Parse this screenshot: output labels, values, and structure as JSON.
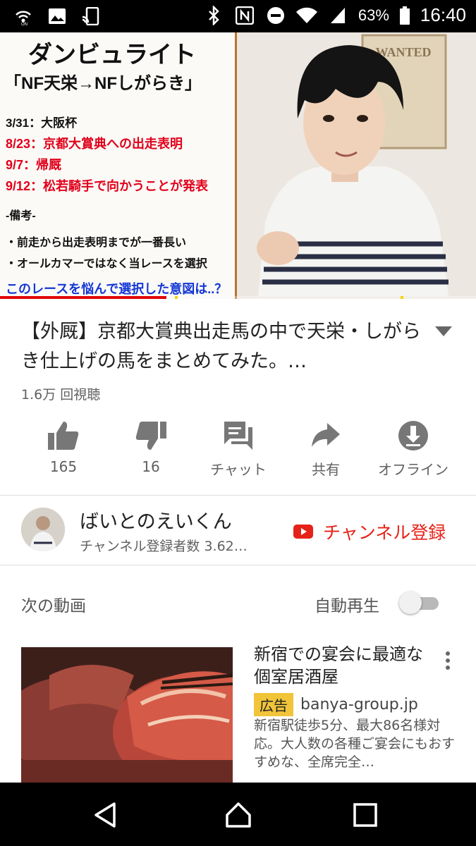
{
  "status_bar": {
    "battery_percent": "63%",
    "time": "16:40",
    "icons": [
      "wifi-calling-icon",
      "image-icon",
      "cast-icon",
      "bluetooth-icon",
      "nfc-icon",
      "do-not-disturb-icon",
      "wifi-icon",
      "signal-icon",
      "battery-icon"
    ]
  },
  "video": {
    "board_title": "ダンビュライト",
    "board_subtitle": "「NF天栄→NFしがらき」",
    "board_lines": [
      {
        "text": "3/31：大阪杯",
        "style": "black"
      },
      {
        "text": "8/23：京都大賞典への出走表明",
        "style": "red"
      },
      {
        "text": "9/7：帰厩",
        "style": "red"
      },
      {
        "text": "9/12：松若騎手で向かうことが発表",
        "style": "red"
      },
      {
        "text": "-備考-",
        "style": "note"
      },
      {
        "text": "・前走から出走表明までが一番長い",
        "style": "note"
      },
      {
        "text": "・オールカマーではなく当レースを選択",
        "style": "note"
      },
      {
        "text": "このレースを悩んで選択した意図は..？",
        "style": "blue"
      }
    ],
    "poster_text": "WANTED",
    "progress": 0.35,
    "accent_color": "#e00000",
    "ad_marker_color": "#f5d200"
  },
  "title": "【外厩】京都大賞典出走馬の中で天栄・しがらき仕上げの馬をまとめてみた。…",
  "views": "1.6万 回視聴",
  "actions": [
    {
      "icon": "thumbs-up-icon",
      "label": "165"
    },
    {
      "icon": "thumbs-down-icon",
      "label": "16"
    },
    {
      "icon": "chat-icon",
      "label": "チャット"
    },
    {
      "icon": "share-icon",
      "label": "共有"
    },
    {
      "icon": "download-icon",
      "label": "オフライン"
    }
  ],
  "channel": {
    "name": "ばいとのえいくん",
    "subscribers": "チャンネル登録者数 3.62…",
    "subscribe_label": "チャンネル登録",
    "subscribe_color": "#e62117"
  },
  "up_next": {
    "label": "次の動画",
    "autoplay_label": "自動再生",
    "autoplay_on": false
  },
  "ad_card": {
    "title": "新宿での宴会に最適な個室居酒屋",
    "badge": "広告",
    "url": "banya-group.jp",
    "description": "新宿駅徒歩5分、最大86名様対応。大人数の各種ご宴会にもおすすめな、全席完全…",
    "badge_color": "#f1c43a"
  },
  "nav_bar": {
    "buttons": [
      "back-icon",
      "home-icon",
      "recents-icon"
    ]
  }
}
